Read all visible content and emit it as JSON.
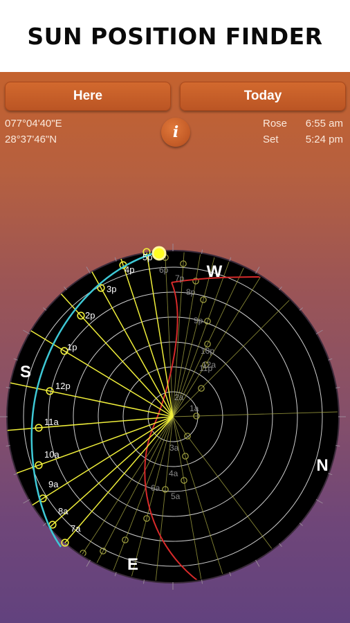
{
  "header": {
    "title": "SUN POSITION FINDER"
  },
  "controls": {
    "here_label": "Here",
    "today_label": "Today",
    "info_label": "i"
  },
  "location": {
    "longitude": "077°04'40\"E",
    "latitude": "28°37'46\"N"
  },
  "sun_times": {
    "rose_label": "Rose",
    "rose_time": "6:55 am",
    "set_label": "Set",
    "set_time": "5:24 pm"
  },
  "compass": {
    "west": "W",
    "south": "S",
    "north": "N",
    "east": "E"
  },
  "sun_path": {
    "day_hours": [
      "7a",
      "8a",
      "9a",
      "10a",
      "11a",
      "12p",
      "1p",
      "2p",
      "3p",
      "4p",
      "5p"
    ],
    "night_hours": [
      "6p",
      "7p",
      "8p",
      "9p",
      "10p",
      "11p",
      "12a",
      "1a",
      "2a",
      "3a",
      "4a",
      "5a",
      "6a"
    ]
  },
  "colors": {
    "sun": "#ffff22",
    "hour_lines": "#f0ef3a",
    "day_path": "#3ec9d6",
    "night_path": "#d82a2a",
    "dial": "#000000"
  }
}
